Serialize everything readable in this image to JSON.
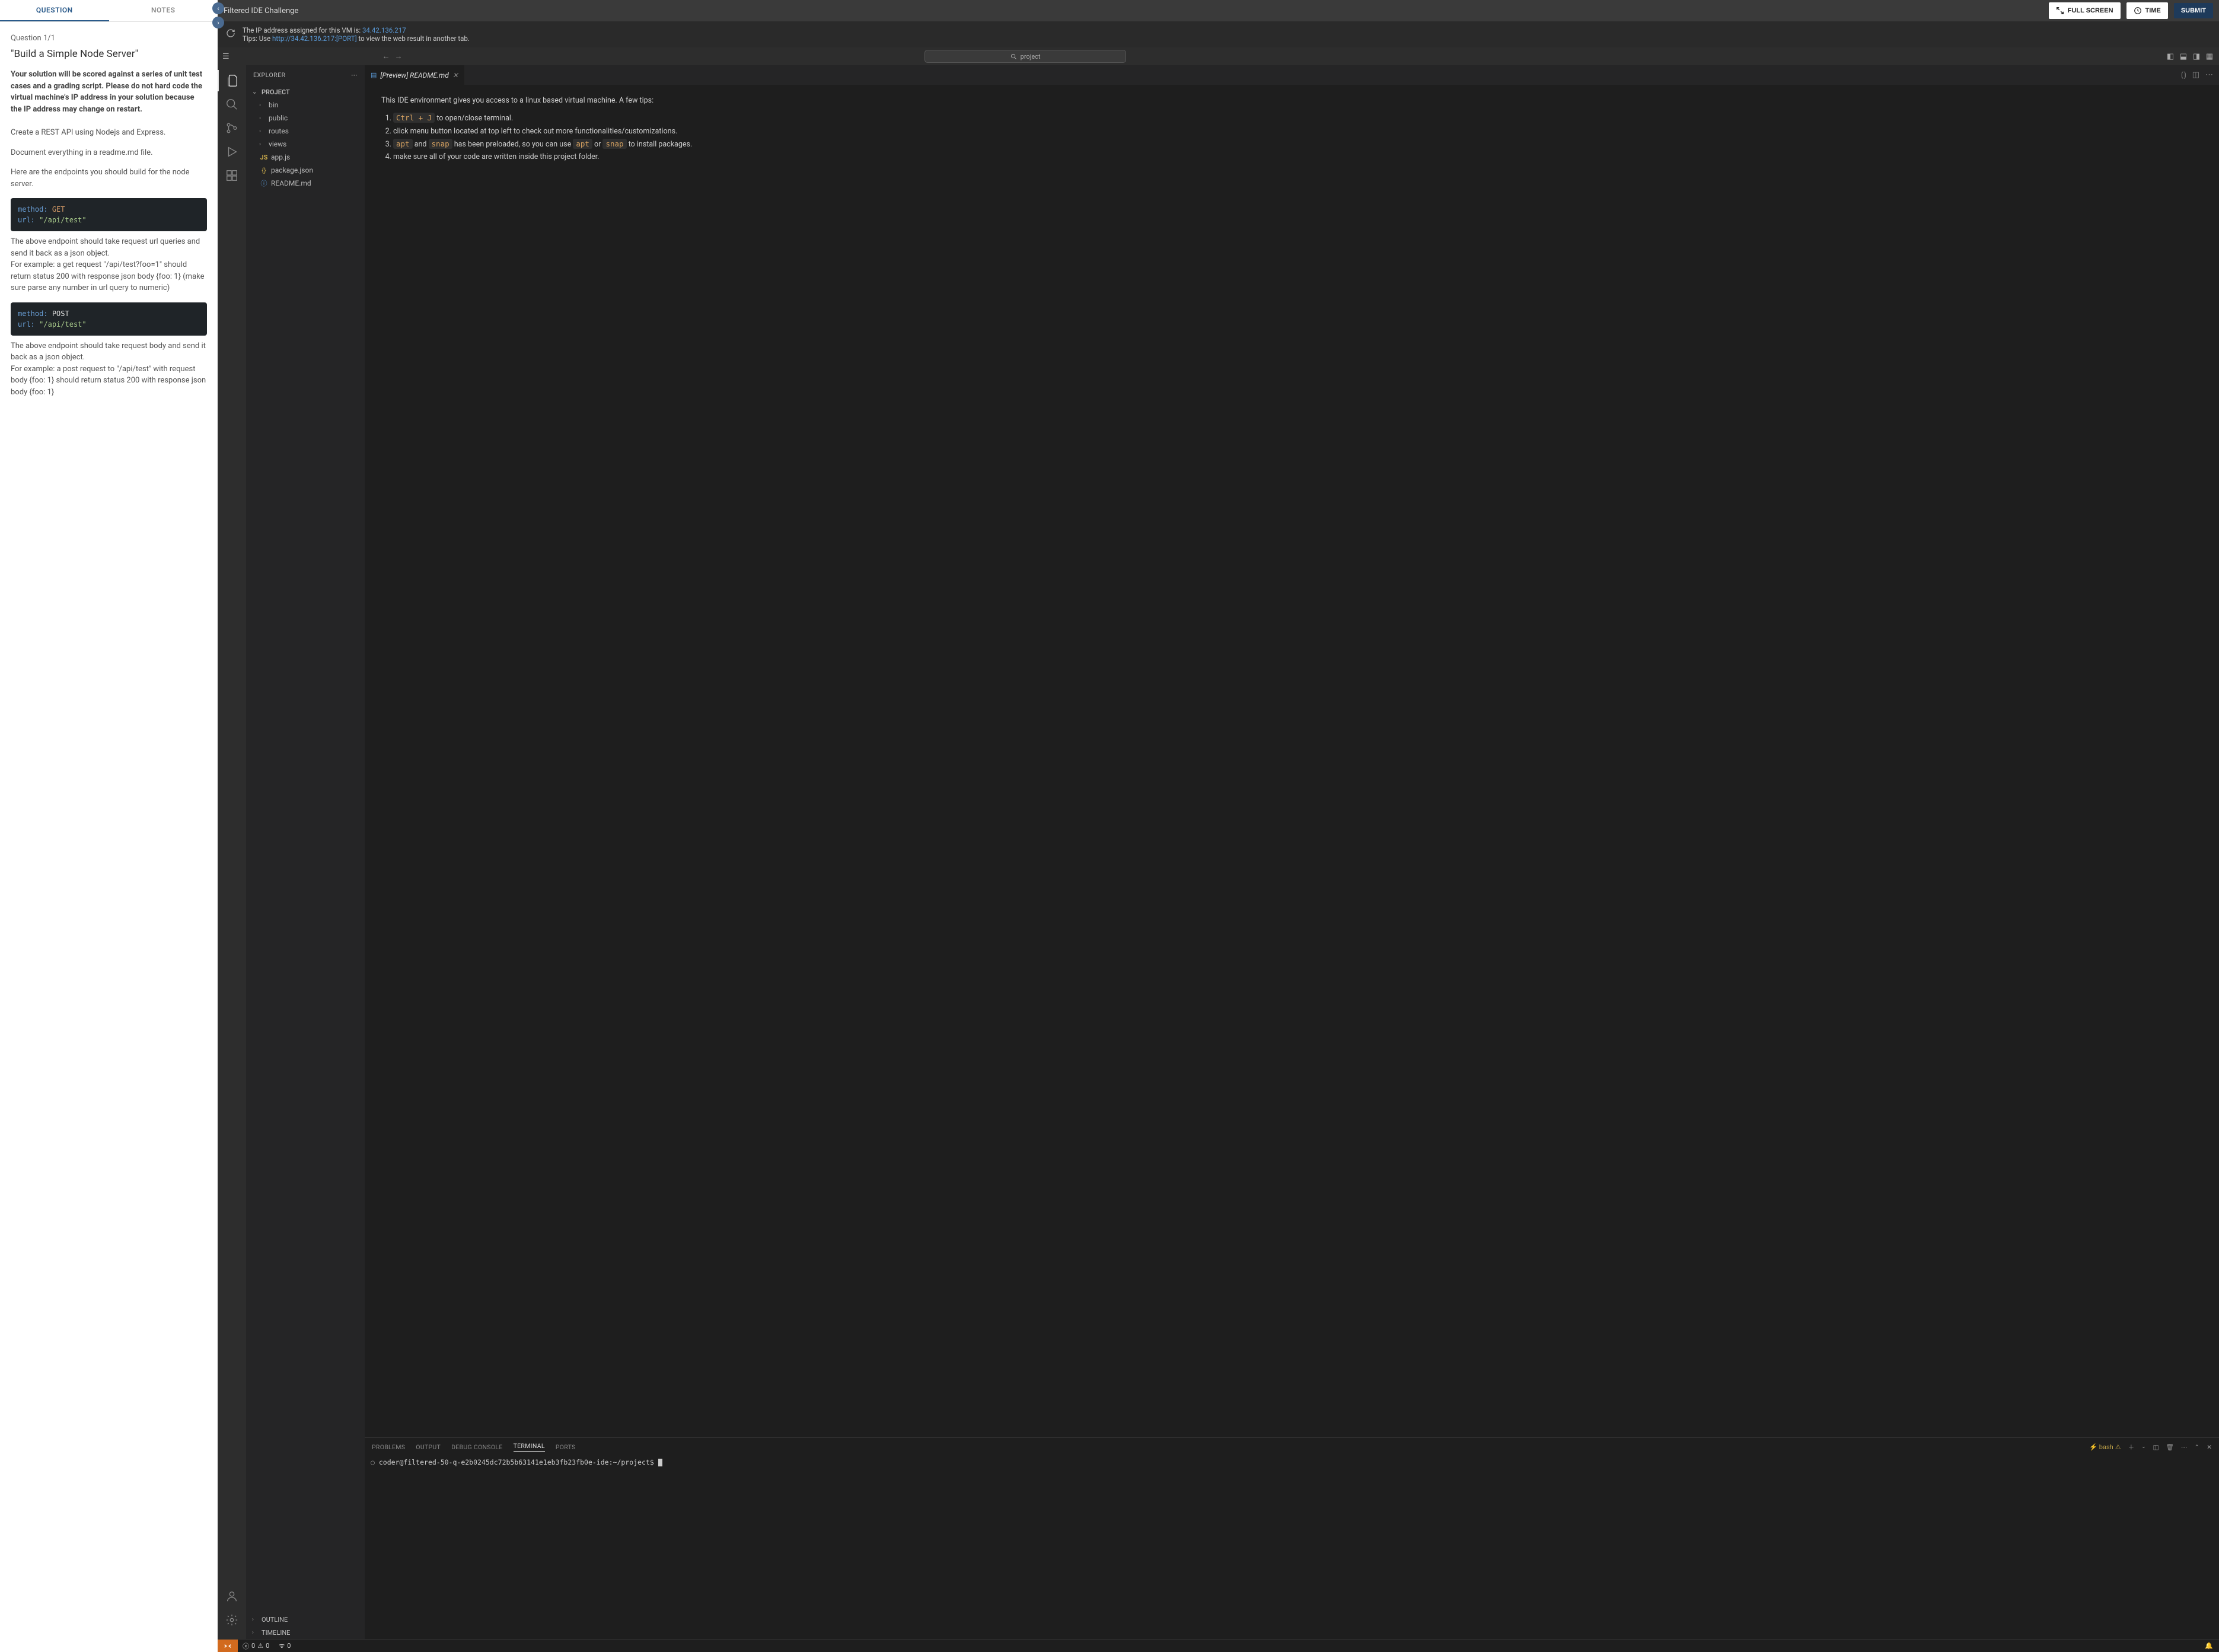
{
  "tabs": {
    "question": "QUESTION",
    "notes": "NOTES"
  },
  "question": {
    "num": "Question 1/1",
    "title": "\"Build a Simple Node Server\"",
    "bold": "Your solution will be scored against a series of unit test cases and a grading script. Please do not hard code the virtual machine's IP address in your solution because the IP address may change on restart.",
    "p1": "Create a REST API using Nodejs and Express.",
    "p2": "Document everything in a readme.md file.",
    "p3": "Here are the endpoints you should build for the node server.",
    "code1": {
      "method_kw": "method:",
      "method_val": "GET",
      "url_kw": "url:",
      "url_val": "\"/api/test\""
    },
    "p4a": "The above endpoint should take request url queries and send it back as a json object.",
    "p4b": "For example: a get request \"/api/test?foo=1\" should return status 200 with response json body {foo: 1} (make sure parse any number in url query to numeric)",
    "code2": {
      "method_kw": "method:",
      "method_val": "POST",
      "url_kw": "url:",
      "url_val": "\"/api/test\""
    },
    "p5a": "The above endpoint should take request body and send it back as a json object.",
    "p5b": "For example: a post request to \"/api/test\" with request body {foo: 1} should return status 200 with response json body {foo: 1}"
  },
  "header": {
    "title": "Filtered IDE Challenge",
    "full_screen": "FULL SCREEN",
    "time": "TIME",
    "submit": "SUBMIT"
  },
  "banner": {
    "line1_pre": "The IP address assigned for this VM is: ",
    "ip": "34.42.136.217",
    "line2_pre": "Tips: Use ",
    "link": "http://34.42.136.217:[PORT]",
    "line2_post": " to view the web result in another tab."
  },
  "ide": {
    "search": "project",
    "explorer_label": "EXPLORER",
    "project_label": "PROJECT",
    "tree": {
      "bin": "bin",
      "public": "public",
      "routes": "routes",
      "views": "views",
      "appjs": "app.js",
      "pkg": "package.json",
      "readme": "README.md"
    },
    "outline": "OUTLINE",
    "timeline": "TIMELINE",
    "tab_label": "[Preview] README.md",
    "preview": {
      "intro": "This IDE environment gives you access to a linux based virtual machine. A few tips:",
      "li1_code": "Ctrl + J",
      "li1_rest": " to open/close terminal.",
      "li2": "click menu button located at top left to check out more functionalities/customizations.",
      "li3_code1": "apt",
      "li3_mid1": " and ",
      "li3_code2": "snap",
      "li3_mid2": " has been preloaded, so you can use ",
      "li3_code3": "apt",
      "li3_mid3": " or ",
      "li3_code4": "snap",
      "li3_rest": " to install packages.",
      "li4": "make sure all of your code are written inside this project folder."
    },
    "terminal_tabs": {
      "problems": "PROBLEMS",
      "output": "OUTPUT",
      "debug": "DEBUG CONSOLE",
      "terminal": "TERMINAL",
      "ports": "PORTS"
    },
    "shell_name": "bash",
    "prompt": "coder@filtered-50-q-e2b0245dc72b5b63141e1eb3fb23fb0e-ide:~/project$ ",
    "status": {
      "errors": "0",
      "warnings": "0",
      "ports": "0"
    }
  }
}
